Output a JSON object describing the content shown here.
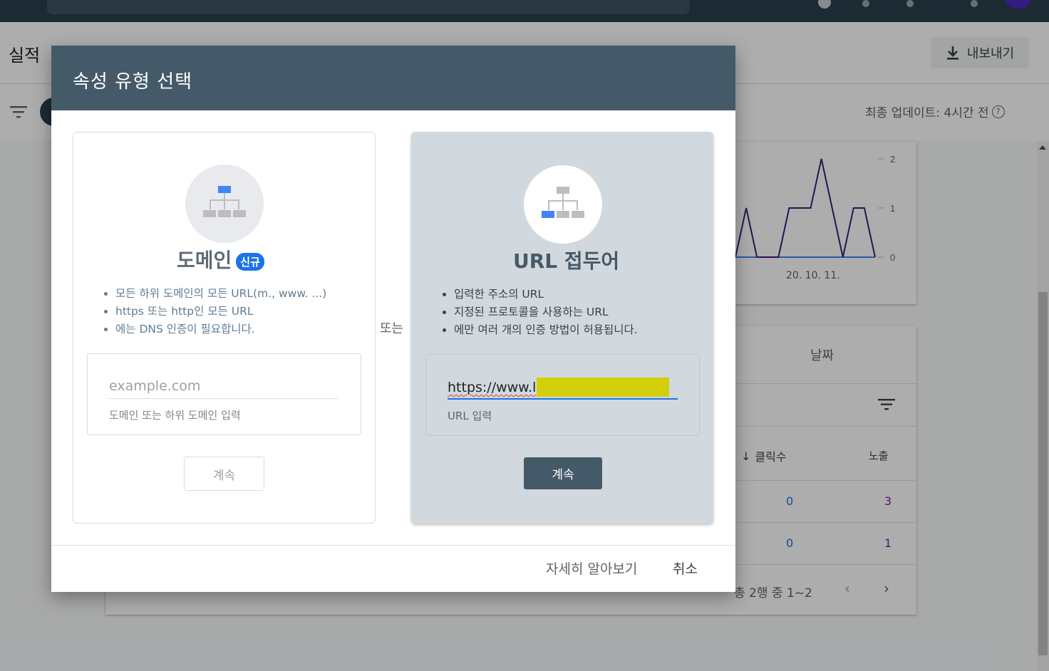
{
  "app": {
    "page_title": "실적",
    "export_label": "내보내기",
    "last_updated": "최종 업데이트: 4시간 전",
    "help_glyph": "?"
  },
  "chart": {
    "chart_data": {
      "type": "line",
      "y_ticks": [
        "2",
        "1",
        "0"
      ],
      "x_ticks": [
        "20. 10. 11."
      ],
      "ylim": [
        0,
        2
      ],
      "series": [
        {
          "color": "#3b1f7a",
          "values": [
            0,
            1,
            0,
            0,
            0,
            1,
            1,
            1,
            2,
            1,
            0,
            1,
            1,
            0
          ]
        },
        {
          "color": "#4285f4",
          "values": [
            0,
            0,
            0,
            0,
            0,
            0,
            0,
            0,
            0,
            0,
            0,
            0,
            0,
            0
          ]
        }
      ]
    }
  },
  "table": {
    "date_header": "날짜",
    "col_clicks": "클릭수",
    "col_impressions": "노출",
    "rows": [
      {
        "clicks": "0",
        "impressions": "3"
      },
      {
        "clicks": "0",
        "impressions": "1"
      }
    ],
    "pagination": "총 2행 중 1~2"
  },
  "dialog": {
    "title": "속성 유형 선택",
    "or_label": "또는",
    "domain": {
      "title": "도메인",
      "badge": "신규",
      "bullets": [
        "모든 하위 도메인의 모든 URL(m., www. ...)",
        "https 또는 http인 모든 URL",
        "에는 DNS 인증이 필요합니다."
      ],
      "placeholder": "example.com",
      "helper": "도메인 또는 하위 도메인 입력",
      "continue": "계속"
    },
    "url_prefix": {
      "title": "URL 접두어",
      "bullets": [
        "입력한 주소의 URL",
        "지정된 프로토콜을 사용하는 URL",
        "에만 여러 개의 인증 방법이 허용됩니다."
      ],
      "value": "https://www.l",
      "helper": "URL 입력",
      "continue": "계속"
    },
    "learn_more": "자세히 알아보기",
    "cancel": "취소"
  },
  "colors": {
    "header": "#455a68",
    "accent": "#1a73e8",
    "selected_panel": "#d1d9de",
    "redaction": "#d3cf0d"
  }
}
